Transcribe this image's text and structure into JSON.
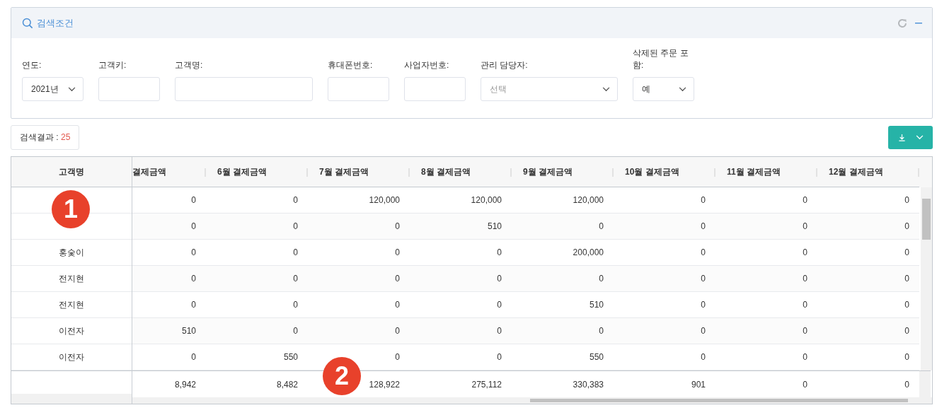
{
  "panel": {
    "title": "검색조건"
  },
  "filters": [
    {
      "label": "연도:",
      "kind": "select",
      "value": "2021년"
    },
    {
      "label": "고객키:",
      "kind": "text"
    },
    {
      "label": "고객명:",
      "kind": "text"
    },
    {
      "label": "휴대폰번호:",
      "kind": "text"
    },
    {
      "label": "사업자번호:",
      "kind": "text"
    },
    {
      "label": "관리 담당자:",
      "kind": "select",
      "placeholder": "선택"
    },
    {
      "label": "삭제된 주문 포함:",
      "kind": "select",
      "value": "예"
    }
  ],
  "results": {
    "label": "검색결과 : ",
    "count": "25"
  },
  "table": {
    "frozen_column": "고객명",
    "columns": [
      "결제금액",
      "6월 결제금액",
      "7월 결제금액",
      "8월 결제금액",
      "9월 결제금액",
      "10월 결제금액",
      "11월 결제금액",
      "12월 결제금액"
    ],
    "rows": [
      {
        "cells": [
          "0",
          "0",
          "120,000",
          "120,000",
          "120,000",
          "0",
          "0",
          "0"
        ]
      },
      {
        "cells": [
          "0",
          "0",
          "0",
          "510",
          "0",
          "0",
          "0",
          "0"
        ]
      },
      {
        "name": "홍숯이",
        "cells": [
          "0",
          "0",
          "0",
          "0",
          "200,000",
          "0",
          "0",
          "0"
        ]
      },
      {
        "name": "전지현",
        "cells": [
          "0",
          "0",
          "0",
          "0",
          "0",
          "0",
          "0",
          "0"
        ]
      },
      {
        "name": "전지현",
        "cells": [
          "0",
          "0",
          "0",
          "0",
          "510",
          "0",
          "0",
          "0"
        ]
      },
      {
        "name": "이전자",
        "cells": [
          "510",
          "0",
          "0",
          "0",
          "0",
          "0",
          "0",
          "0"
        ]
      },
      {
        "name": "이전자",
        "cells": [
          "0",
          "550",
          "0",
          "0",
          "550",
          "0",
          "0",
          "0"
        ]
      }
    ],
    "totals": [
      "8,942",
      "8,482",
      "128,922",
      "275,112",
      "330,383",
      "901",
      "0",
      "0"
    ]
  },
  "markers": [
    "1",
    "2"
  ]
}
